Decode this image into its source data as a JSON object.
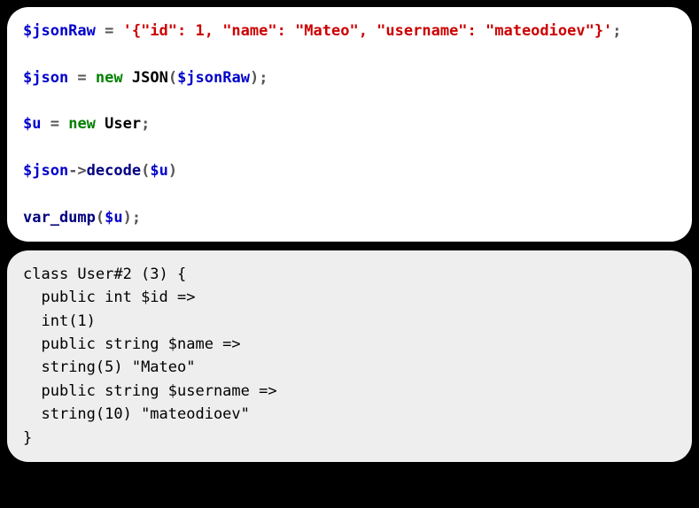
{
  "code": {
    "l1_var": "$jsonRaw",
    "l1_op1": " = ",
    "l1_str": "'{\"id\": 1, \"name\": \"Mateo\", \"username\": \"mateodioev\"}'",
    "l1_semi": ";",
    "l3_var": "$json",
    "l3_op1": " = ",
    "l3_kw": "new",
    "l3_cls": " JSON",
    "l3_p1": "(",
    "l3_arg": "$jsonRaw",
    "l3_p2": ")",
    "l3_semi": ";",
    "l5_var": "$u",
    "l5_op1": " = ",
    "l5_kw": "new",
    "l5_cls": " User",
    "l5_semi": ";",
    "l7_var": "$json",
    "l7_op1": "->",
    "l7_fn": "decode",
    "l7_p1": "(",
    "l7_arg": "$u",
    "l7_p2": ")",
    "l9_fn": "var_dump",
    "l9_p1": "(",
    "l9_arg": "$u",
    "l9_p2": ")",
    "l9_semi": ";"
  },
  "output": {
    "o1": "class User#2 (3) {",
    "o2": "  public int $id =>",
    "o3": "  int(1)",
    "o4": "  public string $name =>",
    "o5": "  string(5) \"Mateo\"",
    "o6": "  public string $username =>",
    "o7": "  string(10) \"mateodioev\"",
    "o8": "}"
  }
}
